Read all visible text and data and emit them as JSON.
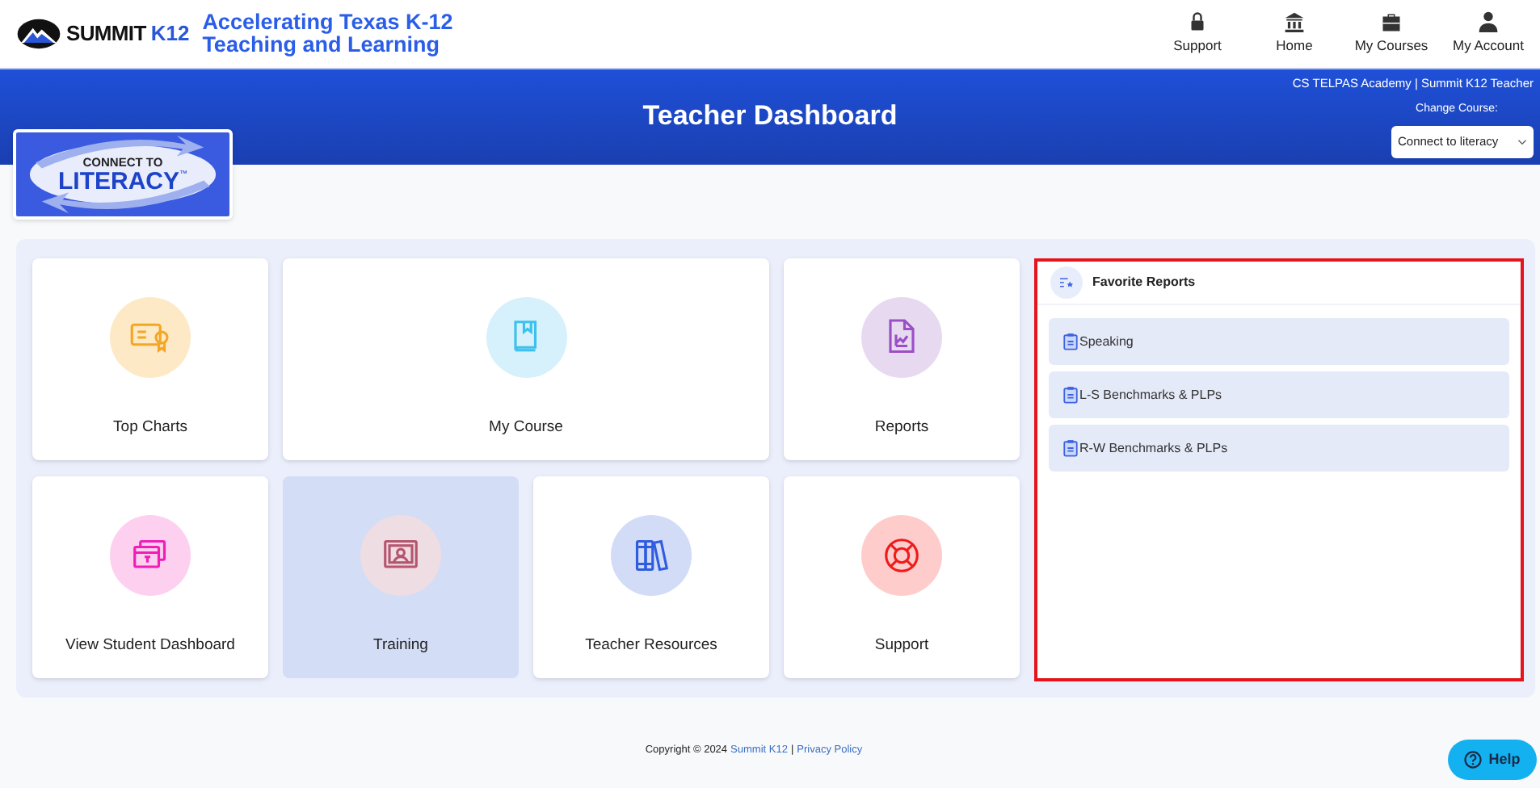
{
  "header": {
    "brand": "SUMMIT",
    "brand_suffix": "K12",
    "tagline": [
      "Accelerating Texas K-12",
      "Teaching and Learning"
    ],
    "nav": [
      {
        "kind": "support",
        "label": "Support"
      },
      {
        "kind": "home",
        "label": "Home"
      },
      {
        "kind": "courses",
        "label": "My Courses"
      },
      {
        "kind": "account",
        "label": "My Account"
      }
    ]
  },
  "banner": {
    "title": "Teacher Dashboard",
    "user": "CS TELPAS Academy | Summit K12 Teacher",
    "course_label": "Change Course:",
    "course_value": "Connect to literacy",
    "logo_top": "CONNECT TO",
    "logo_main": "LITERACY",
    "logo_mark": "™"
  },
  "tiles": [
    {
      "kind": "certificate",
      "label": "Top Charts",
      "selected": false
    },
    {
      "kind": "book",
      "label": "My Course",
      "selected": false
    },
    {
      "kind": "report",
      "label": "Reports",
      "selected": false
    },
    {
      "kind": "student",
      "label": "View Student Dashboard",
      "selected": false
    },
    {
      "kind": "training",
      "label": "Training",
      "selected": true
    },
    {
      "kind": "books",
      "label": "Teacher Resources",
      "selected": false
    },
    {
      "kind": "lifebuoy",
      "label": "Support",
      "selected": false
    }
  ],
  "favorites": {
    "title": "Favorite Reports",
    "items": [
      "Speaking",
      "L-S Benchmarks & PLPs",
      "R-W Benchmarks & PLPs"
    ]
  },
  "footer": {
    "copyright": "Copyright © 2024",
    "link": "Summit K12",
    "separator": "|",
    "privacy": "Privacy Policy"
  },
  "help": "Help"
}
